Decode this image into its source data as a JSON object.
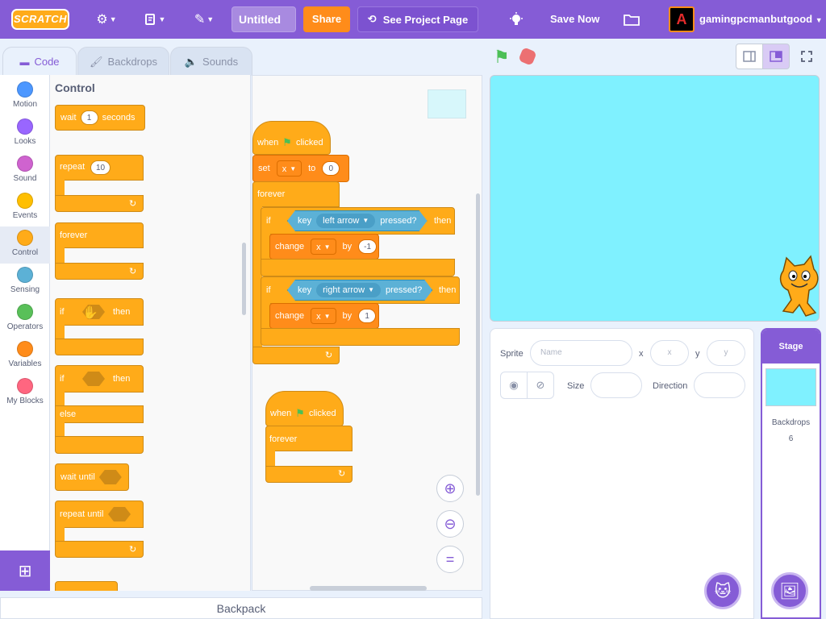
{
  "menubar": {
    "logo": "SCRATCH",
    "project_title": "Untitled",
    "share_label": "Share",
    "see_project_label": "See Project Page",
    "save_now_label": "Save Now",
    "username": "gamingpcmanbutgood",
    "avatar_glyph": "A"
  },
  "tabs": {
    "code": "Code",
    "backdrops": "Backdrops",
    "sounds": "Sounds"
  },
  "categories": [
    {
      "label": "Motion",
      "color": "#4c97ff"
    },
    {
      "label": "Looks",
      "color": "#9966ff"
    },
    {
      "label": "Sound",
      "color": "#cf63cf"
    },
    {
      "label": "Events",
      "color": "#ffbf00"
    },
    {
      "label": "Control",
      "color": "#ffab19"
    },
    {
      "label": "Sensing",
      "color": "#5cb1d6"
    },
    {
      "label": "Operators",
      "color": "#59c059"
    },
    {
      "label": "Variables",
      "color": "#ff8c1a"
    },
    {
      "label": "My Blocks",
      "color": "#ff6680"
    }
  ],
  "palette": {
    "title": "Control",
    "wait": {
      "pre": "wait",
      "value": "1",
      "post": "seconds"
    },
    "repeat": {
      "label": "repeat",
      "value": "10"
    },
    "forever": "forever",
    "if_then": {
      "if": "if",
      "then": "then"
    },
    "if_else": {
      "if": "if",
      "then": "then",
      "else": "else"
    },
    "wait_until": "wait until",
    "repeat_until": "repeat until"
  },
  "script": {
    "hat1": {
      "when": "when",
      "clicked": "clicked"
    },
    "set": {
      "label": "set",
      "var": "x",
      "to": "to",
      "value": "0"
    },
    "forever": "forever",
    "if1": {
      "if": "if",
      "key": "key",
      "key_value": "left arrow",
      "pressed": "pressed?",
      "then": "then",
      "change": "change",
      "var": "x",
      "by": "by",
      "value": "-1"
    },
    "if2": {
      "if": "if",
      "key": "key",
      "key_value": "right arrow",
      "pressed": "pressed?",
      "then": "then",
      "change": "change",
      "var": "x",
      "by": "by",
      "value": "1"
    },
    "hat2": {
      "when": "when",
      "clicked": "clicked"
    },
    "forever2": "forever",
    "zoom_reset": "="
  },
  "backpack": "Backpack",
  "sprite_info": {
    "sprite_label": "Sprite",
    "name_placeholder": "Name",
    "x_label": "x",
    "x_placeholder": "x",
    "y_label": "y",
    "y_placeholder": "y",
    "size_label": "Size",
    "direction_label": "Direction"
  },
  "stage_panel": {
    "header": "Stage",
    "backdrops_label": "Backdrops",
    "backdrops_count": "6"
  },
  "colors": {
    "control": "#ffab19",
    "sensing": "#5cb1d6",
    "accent": "#855cd6",
    "stage_bg": "#7ff1ff"
  },
  "icons": [
    "gear-icon",
    "file-icon",
    "edit-icon",
    "remix-icon",
    "lightbulb-icon",
    "folder-icon",
    "green-flag-icon",
    "stop-icon",
    "zoom-in-icon",
    "zoom-out-icon",
    "eye-icon",
    "eye-off-icon",
    "add-extension-icon",
    "choose-sprite-icon",
    "choose-backdrop-icon"
  ]
}
